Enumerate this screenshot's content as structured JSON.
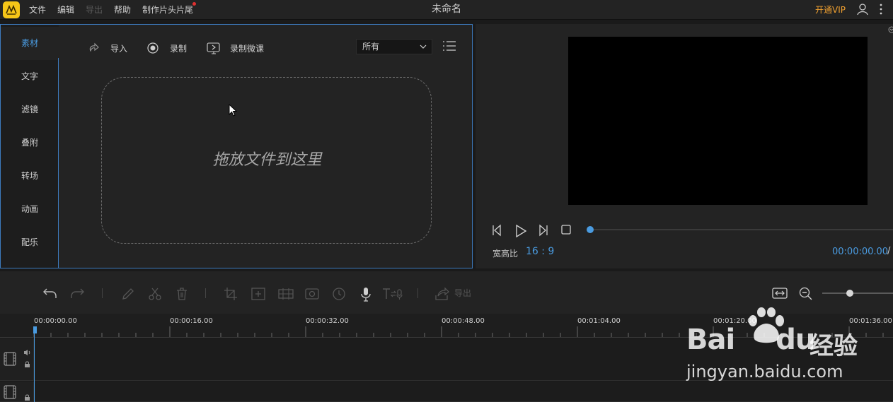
{
  "app": {
    "window_title": "未命名",
    "vip_label": "开通VIP",
    "menus": [
      "文件",
      "编辑",
      "导出",
      "帮助",
      "制作片头片尾"
    ]
  },
  "side_nav": [
    "素材",
    "文字",
    "滤镜",
    "叠附",
    "转场",
    "动画",
    "配乐"
  ],
  "media_toolbar": {
    "import_label": "导入",
    "record_label": "录制",
    "record_lesson_label": "录制微课",
    "filter_value": "所有"
  },
  "dropzone": {
    "text": "拖放文件到这里"
  },
  "preview": {
    "ratio_label": "宽高比",
    "ratio_value": "16 : 9",
    "timecode": "00:00:00.00",
    "timecode_sep": "/"
  },
  "timeline": {
    "export_label": "导出",
    "ruler_labels": [
      "00:00:00.00",
      "00:00:16.00",
      "00:00:32.00",
      "00:00:48.00",
      "00:01:04.00",
      "00:01:20.00",
      "00:01:36.00"
    ]
  },
  "watermark": {
    "brand": "Bai",
    "brand2": "du",
    "product": "经验",
    "url": "jingyan.baidu.com"
  },
  "colors": {
    "accent": "#4a9be0",
    "vip": "#f0a030",
    "logo": "#f5c518",
    "background": "#1a1a1a",
    "panel": "#232323"
  }
}
